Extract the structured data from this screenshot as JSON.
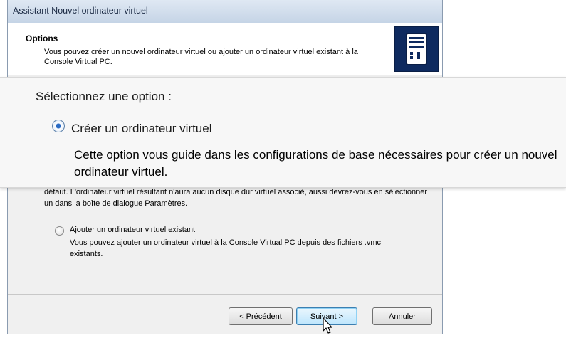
{
  "window": {
    "title": "Assistant Nouvel ordinateur virtuel"
  },
  "header": {
    "title": "Options",
    "description": "Vous pouvez créer un nouvel ordinateur virtuel ou ajouter un ordinateur virtuel existant à la Console Virtual PC.",
    "icon": "computer-tower-icon"
  },
  "zoom": {
    "prompt": "Sélectionnez une option :",
    "option_label": "Créer un ordinateur virtuel",
    "option_description": "Cette option vous guide dans les configurations de base nécessaires pour créer un nouvel ordinateur virtuel."
  },
  "body": {
    "option1_description_tail": "défaut. L'ordinateur virtuel résultant n'aura aucun disque dur virtuel associé, aussi devrez-vous en sélectionner un dans la boîte de dialogue Paramètres.",
    "option2_label": "Ajouter un ordinateur virtuel existant",
    "option2_description": "Vous pouvez ajouter un ordinateur virtuel à la Console Virtual PC depuis des fichiers .vmc existants."
  },
  "buttons": {
    "back": "< Précédent",
    "next": "Suivant >",
    "cancel": "Annuler"
  },
  "colors": {
    "header_icon_bg": "#0e2a5f",
    "default_button_border": "#3c7fb1"
  }
}
